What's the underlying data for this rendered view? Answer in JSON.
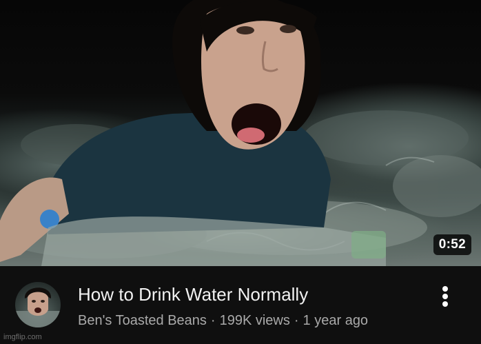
{
  "video": {
    "duration": "0:52",
    "title": "How to Drink Water Normally",
    "channel": "Ben's Toasted Beans",
    "views": "199K views",
    "age": "1 year ago",
    "separator": "·"
  },
  "icons": {
    "more": "more-vert-icon"
  },
  "watermark": "imgflip.com",
  "colors": {
    "background": "#0f0f0f",
    "title": "#f1f1f1",
    "meta": "#aaaaaa"
  }
}
